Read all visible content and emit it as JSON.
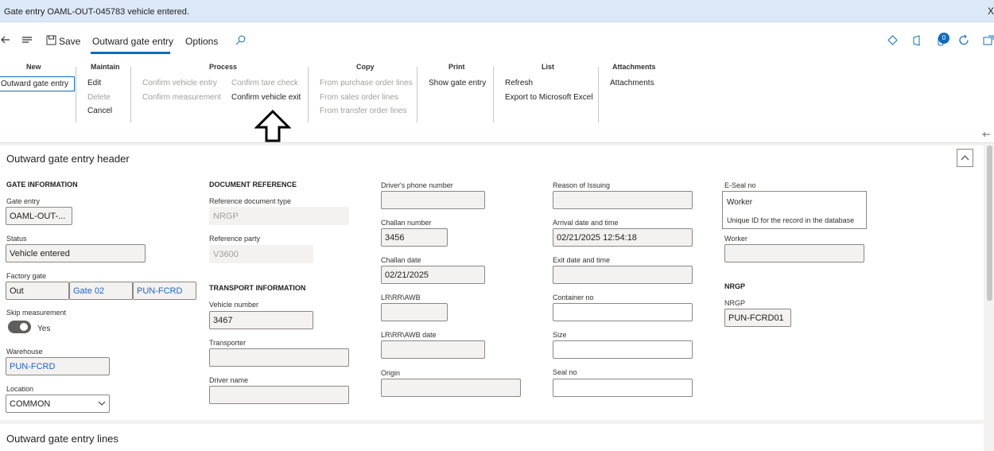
{
  "message_bar": {
    "text": "Gate entry OAML-OUT-045783 vehicle entered.",
    "close": "X"
  },
  "command_bar": {
    "save": "Save",
    "tab_active": "Outward gate entry",
    "tab_options": "Options",
    "badge_count": "0"
  },
  "action_pane": {
    "new": {
      "title": "New",
      "items": [
        "Outward gate entry"
      ]
    },
    "maintain": {
      "title": "Maintain",
      "items": [
        "Edit",
        "Delete",
        "Cancel"
      ]
    },
    "process": {
      "title": "Process",
      "items": [
        "Confirm vehicle entry",
        "Confirm measurement",
        "Confirm tare check",
        "Confirm vehicle exit"
      ]
    },
    "copy": {
      "title": "Copy",
      "items": [
        "From purchase order lines",
        "From sales order lines",
        "From transfer order lines"
      ]
    },
    "print": {
      "title": "Print",
      "items": [
        "Show gate entry"
      ]
    },
    "list": {
      "title": "List",
      "items": [
        "Refresh",
        "Export to Microsoft Excel"
      ]
    },
    "attachments": {
      "title": "Attachments",
      "items": [
        "Attachments"
      ]
    }
  },
  "header": {
    "title": "Outward gate entry header",
    "gate_info": {
      "title": "GATE INFORMATION",
      "gate_entry_label": "Gate entry",
      "gate_entry": "OAML-OUT-...",
      "status_label": "Status",
      "status": "Vehicle entered",
      "factory_gate_label": "Factory gate",
      "factory_gate": "Out",
      "gate": "Gate 02",
      "site": "PUN-FCRD",
      "skip_label": "Skip measurement",
      "skip_value": "Yes",
      "warehouse_label": "Warehouse",
      "warehouse": "PUN-FCRD",
      "location_label": "Location",
      "location": "COMMON"
    },
    "doc_ref": {
      "title": "DOCUMENT REFERENCE",
      "ref_type_label": "Reference document type",
      "ref_type": "NRGP",
      "ref_party_label": "Reference party",
      "ref_party": "V3600"
    },
    "transport": {
      "title": "TRANSPORT INFORMATION",
      "vehicle_label": "Vehicle number",
      "vehicle": "3467",
      "transporter_label": "Transporter",
      "transporter": "",
      "driver_label": "Driver name",
      "driver": ""
    },
    "col3": {
      "phone_label": "Driver's phone number",
      "phone": "",
      "challan_label": "Challan number",
      "challan": "3456",
      "challan_date_label": "Challan date",
      "challan_date": "02/21/2025",
      "lr_label": "LR\\RR\\AWB",
      "lr": "",
      "lr_date_label": "LR\\RR\\AWB date",
      "lr_date": "",
      "origin_label": "Origin",
      "origin": ""
    },
    "col4": {
      "reason_label": "Reason of Issuing",
      "reason": "",
      "arrival_label": "Arrival date and time",
      "arrival": "02/21/2025 12:54:18",
      "exit_label": "Exit date and time",
      "exit": "",
      "container_label": "Container no",
      "container": "",
      "size_label": "Size",
      "size": "",
      "seal_label": "Seal no",
      "seal": ""
    },
    "col5": {
      "eseal_label": "E-Seal no",
      "tooltip_title": "Worker",
      "tooltip_text": "Unique ID for the record in the database",
      "worker_label": "Worker",
      "worker": "",
      "nrgp_title": "NRGP",
      "nrgp_label": "NRGP",
      "nrgp": "PUN-FCRD01"
    }
  },
  "lines": {
    "title": "Outward gate entry lines"
  }
}
